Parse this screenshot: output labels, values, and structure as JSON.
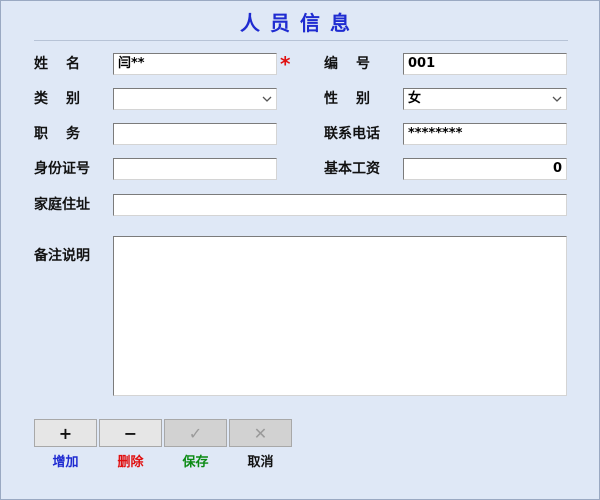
{
  "form": {
    "title": "人员信息",
    "labels": {
      "name": "姓名",
      "number": "编号",
      "category": "类别",
      "gender": "性别",
      "position": "职务",
      "phone": "联系电话",
      "id_card": "身份证号",
      "base_salary": "基本工资",
      "address": "家庭住址",
      "remarks": "备注说明"
    },
    "required_mark": "*",
    "values": {
      "name": "闫**",
      "number": "001",
      "category": "",
      "gender": "女",
      "position": "",
      "phone": "********",
      "id_card": "",
      "base_salary": "0",
      "address": "",
      "remarks": ""
    }
  },
  "toolbar": {
    "add": {
      "glyph": "+",
      "label": "增加",
      "color": "#1f2bd1"
    },
    "delete": {
      "glyph": "−",
      "label": "删除",
      "color": "#e01010"
    },
    "save": {
      "glyph": "✓",
      "label": "保存",
      "color": "#0a8a12"
    },
    "cancel": {
      "glyph": "✕",
      "label": "取消",
      "color": "#111111"
    }
  },
  "icons": {
    "dropdown": "chevron-down-icon"
  }
}
